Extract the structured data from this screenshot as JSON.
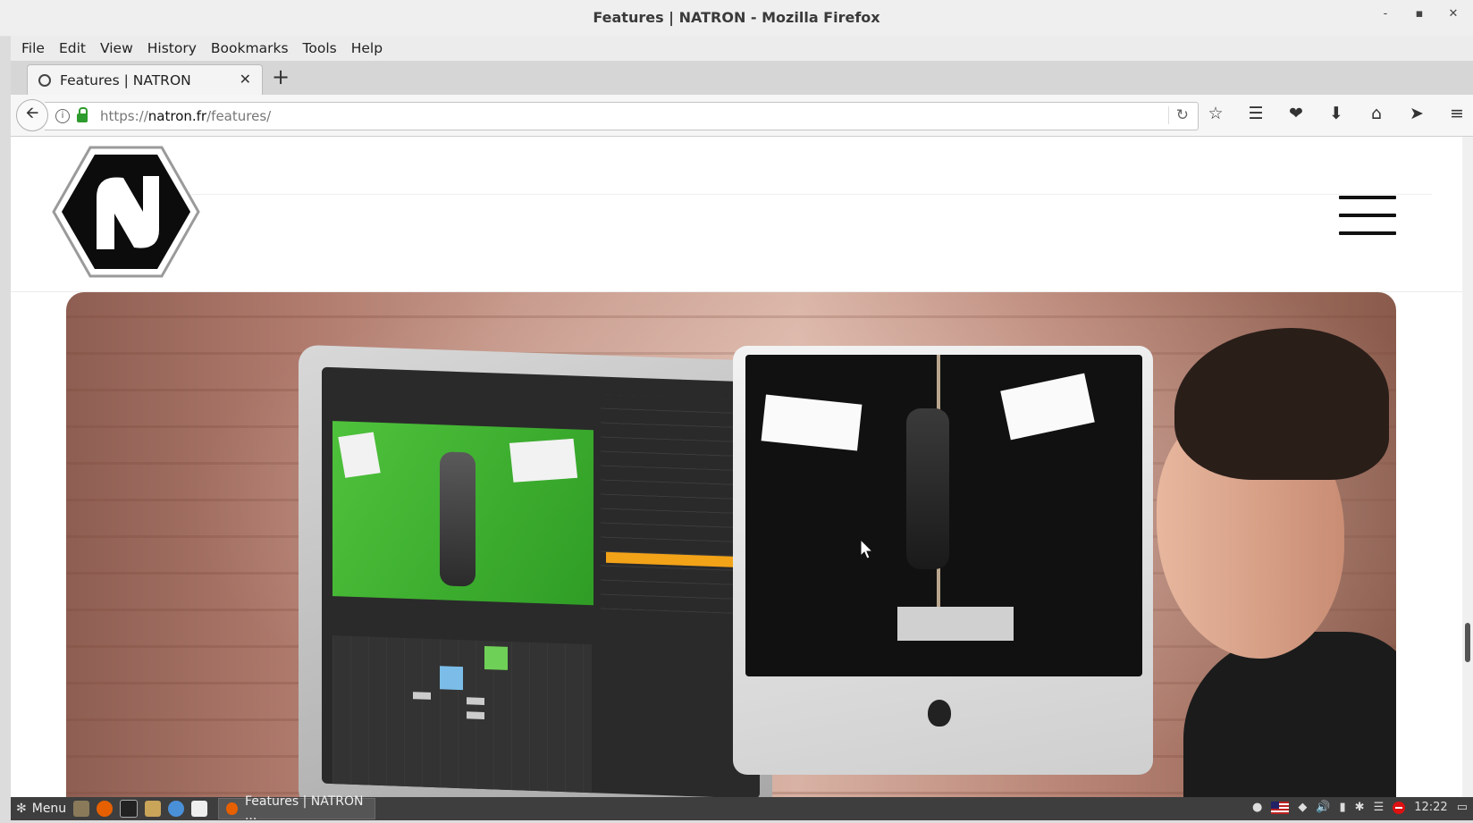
{
  "window": {
    "title": "Features | NATRON - Mozilla Firefox",
    "minimize": "-",
    "maximize": "▪",
    "close": "✕"
  },
  "menubar": {
    "items": [
      "File",
      "Edit",
      "View",
      "History",
      "Bookmarks",
      "Tools",
      "Help"
    ]
  },
  "tabs": {
    "active_label": "Features | NATRON",
    "close_glyph": "✕",
    "new_tab_glyph": "+"
  },
  "navbar": {
    "back_glyph": "🡨",
    "url_prefix": "https://",
    "url_domain": "natron.fr",
    "url_path": "/features/",
    "reload_glyph": "↻",
    "info_glyph": "i",
    "toolbar_icons": [
      "star-icon",
      "reading-list-icon",
      "pocket-icon",
      "download-icon",
      "home-icon",
      "send-icon",
      "hamburger-menu-icon"
    ],
    "toolbar_glyphs": [
      "☆",
      "☰",
      "❤",
      "⬇",
      "⌂",
      "➤",
      "≡"
    ]
  },
  "page": {
    "logo_name": "natron-logo",
    "hero_alt": "Natron compositing software on two monitors"
  },
  "taskbar": {
    "menu_label": "Menu",
    "window_label": "Features | NATRON ...",
    "clock": "12:22"
  }
}
